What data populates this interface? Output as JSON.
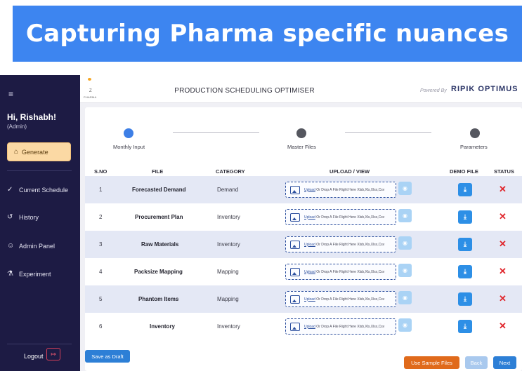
{
  "banner": {
    "title": "Capturing Pharma specific nuances"
  },
  "sidebar": {
    "menu_icon": "≡",
    "greeting": "Hi, Rishabh!",
    "role": "(Admin)",
    "generate_label": "Generate",
    "items": [
      {
        "label": "Current Schedule",
        "icon": "check-icon"
      },
      {
        "label": "History",
        "icon": "history-icon"
      },
      {
        "label": "Admin Panel",
        "icon": "user-icon"
      },
      {
        "label": "Experiment",
        "icon": "flask-icon"
      }
    ],
    "logout_label": "Logout"
  },
  "topbar": {
    "logo_mark": "Z",
    "logo_text": "PHARMA",
    "title": "PRODUCTION SCHEDULING OPTIMISER",
    "powered_by": "Powered By",
    "brand": "RIPIK OPTIMUS"
  },
  "stepper": {
    "steps": [
      {
        "label": "Monthly Input",
        "state": "active"
      },
      {
        "label": "Master Files",
        "state": "pending"
      },
      {
        "label": "Parameters",
        "state": "pending"
      }
    ]
  },
  "table": {
    "headers": [
      "S.NO",
      "FILE",
      "CATEGORY",
      "UPLOAD / VIEW",
      "DEMO FILE",
      "STATUS"
    ],
    "upload_link": "Upload",
    "upload_hint": " Or Drop A File Right Here Xlsb,Xls,Xlsx,Csv",
    "status_mark": "✕",
    "rows": [
      {
        "sno": "1",
        "file": "Forecasted Demand",
        "category": "Demand"
      },
      {
        "sno": "2",
        "file": "Procurement Plan",
        "category": "Inventory"
      },
      {
        "sno": "3",
        "file": "Raw Materials",
        "category": "Inventory"
      },
      {
        "sno": "4",
        "file": "Packsize Mapping",
        "category": "Mapping"
      },
      {
        "sno": "5",
        "file": "Phantom Items",
        "category": "Mapping"
      },
      {
        "sno": "6",
        "file": "Inventory",
        "category": "Inventory"
      }
    ]
  },
  "footer": {
    "save_draft": "Save as Draft",
    "use_sample": "Use Sample Files",
    "back": "Back",
    "next": "Next"
  },
  "colors": {
    "banner": "#3d85f0",
    "sidebar": "#1d1b44",
    "generate": "#fbd9a4",
    "primary": "#2d7fd6",
    "sample": "#e06a1b",
    "status_error": "#e0262c"
  }
}
